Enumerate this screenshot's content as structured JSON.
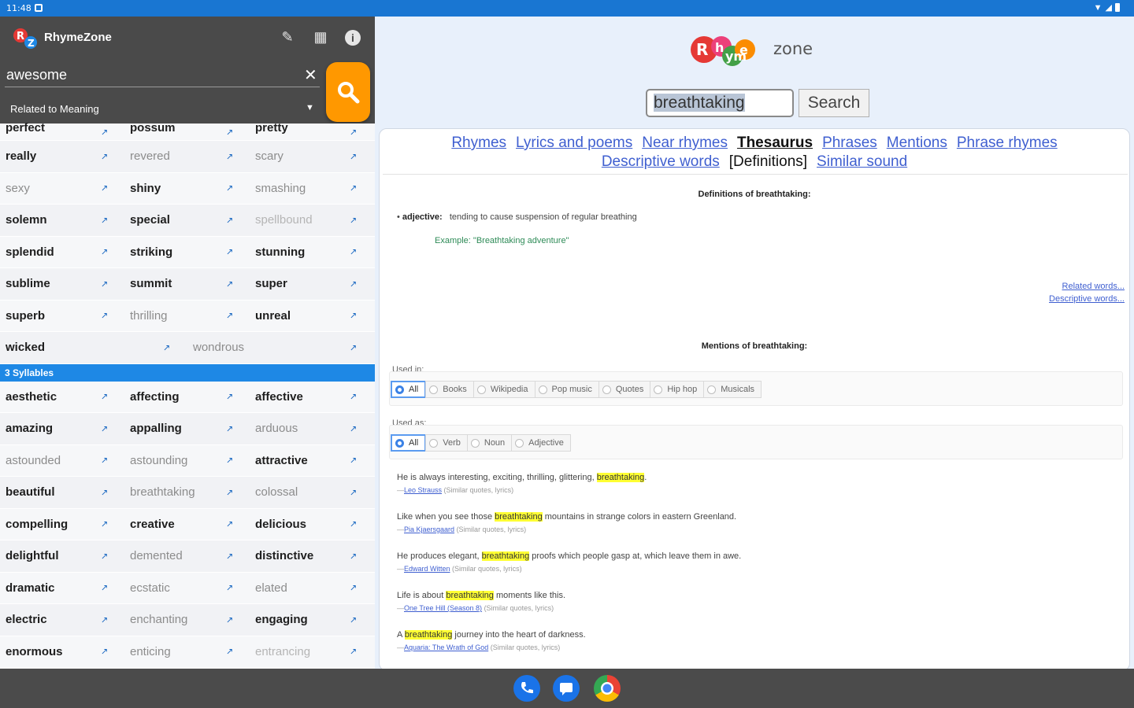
{
  "statusbar": {
    "time": "11:48"
  },
  "app": {
    "title": "RhymeZone",
    "query": "awesome",
    "mode": "Related to Meaning"
  },
  "wordlist": {
    "rows_a": [
      [
        "perfect",
        "possum",
        "pretty"
      ],
      [
        "really",
        "revered",
        "scary"
      ],
      [
        "sexy",
        "shiny",
        "smashing"
      ],
      [
        "solemn",
        "special",
        "spellbound"
      ],
      [
        "splendid",
        "striking",
        "stunning"
      ],
      [
        "sublime",
        "summit",
        "super"
      ],
      [
        "superb",
        "thrilling",
        "unreal"
      ],
      [
        "wicked",
        "wondrous"
      ]
    ],
    "section_label": "3 Syllables",
    "rows_b": [
      [
        "aesthetic",
        "affecting",
        "affective"
      ],
      [
        "amazing",
        "appalling",
        "arduous"
      ],
      [
        "astounded",
        "astounding",
        "attractive"
      ],
      [
        "beautiful",
        "breathtaking",
        "colossal"
      ],
      [
        "compelling",
        "creative",
        "delicious"
      ],
      [
        "delightful",
        "demented",
        "distinctive"
      ],
      [
        "dramatic",
        "ecstatic",
        "elated"
      ],
      [
        "electric",
        "enchanting",
        "engaging"
      ],
      [
        "enormous",
        "enticing",
        "entrancing"
      ]
    ]
  },
  "web": {
    "logo_text": "zone",
    "search_value": "breathtaking",
    "search_button": "Search",
    "nav": {
      "rhymes": "Rhymes",
      "lyrics": "Lyrics and poems",
      "near": "Near rhymes",
      "thesaurus": "Thesaurus",
      "phrases": "Phrases",
      "mentions": "Mentions",
      "phrase_rhymes": "Phrase rhymes",
      "descriptive": "Descriptive words",
      "definitions": "[Definitions]",
      "similar": "Similar sound"
    },
    "definitions_title": "Definitions of breathtaking:",
    "definition_pos": "adjective:",
    "definition_text": "tending to cause suspension of regular breathing",
    "example": "Example: \"Breathtaking adventure\"",
    "related_link": "Related words...",
    "descriptive_link": "Descriptive words...",
    "mentions_title": "Mentions of breathtaking:",
    "used_in_label": "Used in:",
    "used_in": [
      "All",
      "Books",
      "Wikipedia",
      "Pop music",
      "Quotes",
      "Hip hop",
      "Musicals"
    ],
    "used_as_label": "Used as:",
    "used_as": [
      "All",
      "Verb",
      "Noun",
      "Adjective"
    ],
    "mentions": [
      {
        "before": "He is always interesting, exciting, thrilling, glittering, ",
        "hl": "breathtaking",
        "after": ".",
        "author": "Leo Strauss",
        "meta": "(Similar quotes, lyrics)"
      },
      {
        "before": "Like when you see those ",
        "hl": "breathtaking",
        "after": " mountains in strange colors in eastern Greenland.",
        "author": "Pia Kjaersgaard",
        "meta": "(Similar quotes, lyrics)"
      },
      {
        "before": "He produces elegant, ",
        "hl": "breathtaking",
        "after": " proofs which people gasp at, which leave them in awe.",
        "author": "Edward Witten",
        "meta": "(Similar quotes, lyrics)"
      },
      {
        "before": "Life is about ",
        "hl": "breathtaking",
        "after": " moments like this.",
        "author": "One Tree Hill (Season 8)",
        "meta": "(Similar quotes, lyrics)"
      },
      {
        "before": "A ",
        "hl": "breathtaking",
        "after": " journey into the heart of darkness.",
        "author": "Aquaria: The Wrath of God",
        "meta": "(Similar quotes, lyrics)"
      }
    ]
  },
  "colors": {
    "statusbar": "#1976d2",
    "appbar": "#4a4a4a",
    "fab": "#ff9800",
    "section": "#1e88e5",
    "link": "#3f5fd0",
    "highlight": "#ffff33"
  }
}
